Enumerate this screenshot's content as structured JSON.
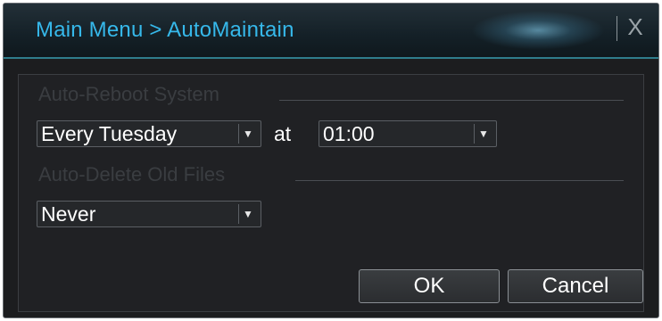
{
  "window": {
    "title": "Main Menu > AutoMaintain",
    "close_label": "X"
  },
  "auto_reboot": {
    "section_label": "Auto-Reboot System",
    "frequency": "Every Tuesday",
    "at_label": "at",
    "time": "01:00"
  },
  "auto_delete": {
    "section_label": "Auto-Delete Old Files",
    "value": "Never"
  },
  "buttons": {
    "ok": "OK",
    "cancel": "Cancel"
  },
  "icons": {
    "dropdown": "chevron-down-icon",
    "close": "close-icon"
  },
  "colors": {
    "title": "#36b8ea",
    "accent_line": "#2f7d8c",
    "background": "#1c1d1f"
  }
}
